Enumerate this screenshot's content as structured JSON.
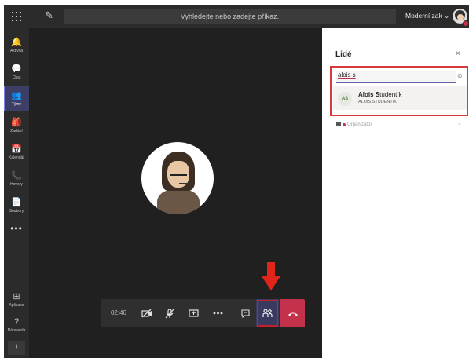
{
  "topbar": {
    "search_placeholder": "Vyhledejte nebo zadejte příkaz.",
    "org_name": "Moderní zak",
    "org_chevron": "⌄",
    "compose_icon": "compose-icon",
    "apps_icon": "apps-grid-icon"
  },
  "rail": {
    "items": [
      {
        "label": "Aktivita",
        "icon": "🔔"
      },
      {
        "label": "Chat",
        "icon": "💬"
      },
      {
        "label": "Týmy",
        "icon": "👥"
      },
      {
        "label": "Zadání",
        "icon": "🎒"
      },
      {
        "label": "Kalendář",
        "icon": "📅"
      },
      {
        "label": "Hovory",
        "icon": "📞"
      },
      {
        "label": "Soubory",
        "icon": "📄"
      }
    ],
    "more": "•••",
    "bottom_items": [
      {
        "label": "Aplikace",
        "icon": "⊞"
      },
      {
        "label": "Nápověda",
        "icon": "?"
      }
    ],
    "download_icon": "⭳",
    "active_index": 2
  },
  "call": {
    "timer": "02:46"
  },
  "panel": {
    "title": "Lidé",
    "close": "×",
    "search_value": "alois s",
    "suggestion": {
      "initials": "AS",
      "name_bold_1": "Alois",
      "name_rest_1": " ",
      "name_bold_2": "S",
      "name_rest_2": "tudentík",
      "login": "ALOIS.STUDENTIK"
    },
    "organizer_label": "Organizátor"
  },
  "colors": {
    "accent": "#6264a7",
    "hangup": "#c4314b",
    "highlight_border": "#d43b3b"
  }
}
